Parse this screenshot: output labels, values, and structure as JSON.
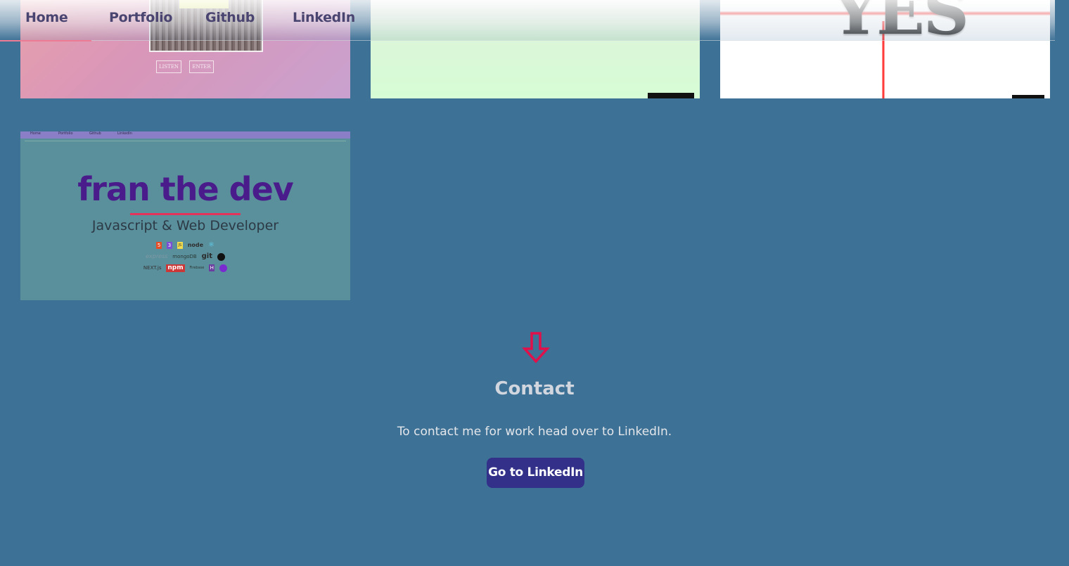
{
  "nav": {
    "items": [
      "Home",
      "Portfolio",
      "Github",
      "LinkedIn"
    ]
  },
  "projects": {
    "thumb1": {
      "buttons": [
        "LISTEN",
        "ENTER"
      ]
    },
    "thumb3": {
      "headline": "YES"
    },
    "thumb4": {
      "nav_items": [
        "Home",
        "Portfolio",
        "Github",
        "LinkedIn"
      ],
      "title": "fran the dev",
      "subtitle": "Javascript & Web Developer",
      "tech_row1": [
        "5",
        "3",
        "JS",
        "node",
        "⚛"
      ],
      "tech_row2": [
        "express",
        "mongoDB",
        "git"
      ],
      "tech_row3": [
        "NEXT.js",
        "npm",
        "Firebase",
        "H"
      ]
    }
  },
  "contact": {
    "title": "Contact",
    "text": "To contact me for work head over to LinkedIn.",
    "button_label": "Go to LinkedIn"
  },
  "colors": {
    "background": "#3e7196",
    "button": "#33308a",
    "arrow": "#e0104a",
    "nav_text": "#4a4470"
  }
}
